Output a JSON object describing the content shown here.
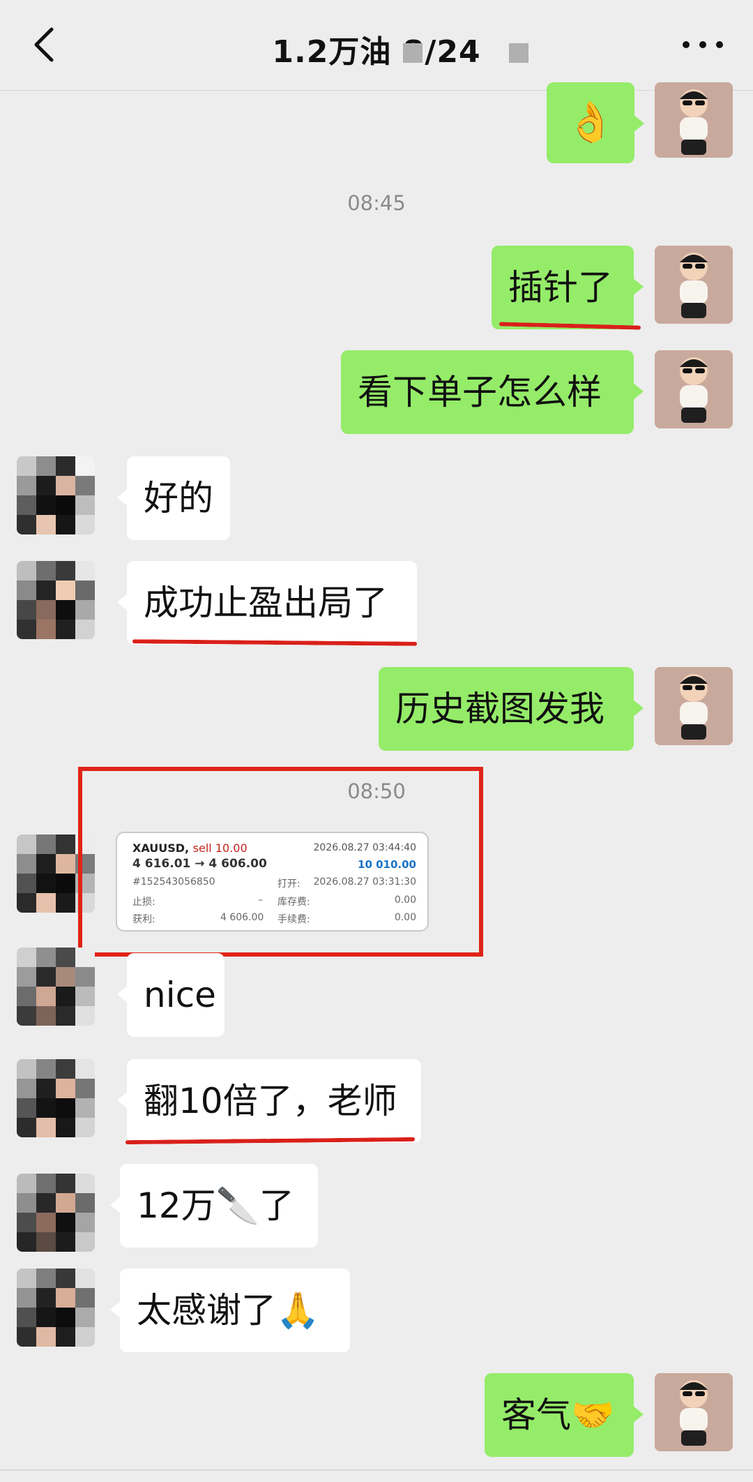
{
  "header": {
    "title": "1.2万油  8/24"
  },
  "messages": {
    "m1_emoji": "👌",
    "time1": "08:45",
    "m2": "插针了",
    "m3": "看下单子怎么样",
    "m4": "好的",
    "m5": "成功止盈出局了",
    "m6": "历史截图发我",
    "time2": "08:50",
    "m8": "nice",
    "m9": "翻10倍了，老师",
    "m10": "12万🔪了",
    "m11": "太感谢了🙏",
    "m12": "客气🤝"
  },
  "trade_card": {
    "symbol": "XAUUSD,",
    "side": "sell 10.00",
    "date_close": "2026.08.27 03:44:40",
    "price": "4 616.01 → 4 606.00",
    "profit": "10 010.00",
    "order_id": "#152543056850",
    "open_label": "打开:",
    "open_time": "2026.08.27 03:31:30",
    "stop_label": "止损:",
    "stop_value": "–",
    "swap_label": "库存费:",
    "swap_value": "0.00",
    "tp_label": "获利:",
    "tp_value": "4 606.00",
    "fee_label": "手续费:",
    "fee_value": "0.00"
  },
  "colors": {
    "accent_green": "#95ec69",
    "background": "#ededed",
    "annotation_red": "#e02418"
  }
}
